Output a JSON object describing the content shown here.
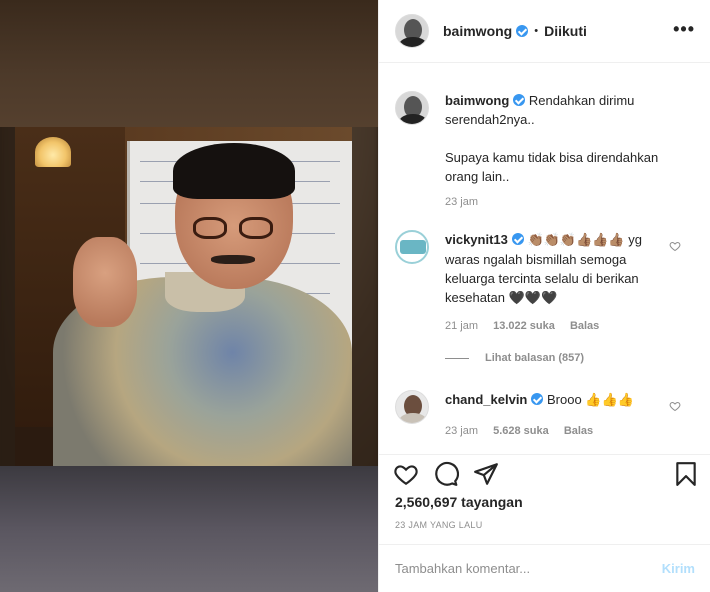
{
  "post": {
    "username": "baimwong",
    "separator": "•",
    "follow_status": "Diikuti",
    "more": "•••"
  },
  "caption": {
    "username": "baimwong",
    "line1": "Rendahkan dirimu",
    "line2": "serendah2nya..",
    "line3": "Supaya kamu tidak bisa direndahkan",
    "line4": "orang lain..",
    "time": "23 jam"
  },
  "comments": [
    {
      "username": "vickynit13",
      "emojis": "👏🏽👏🏽👏🏽👍🏽👍🏽👍🏽",
      "text_end": "yg",
      "line2": "waras ngalah bismillah semoga",
      "line3": "keluarga tercinta selalu di berikan",
      "line4": "kesehatan",
      "hearts": "🖤🖤🖤",
      "time": "21 jam",
      "likes": "13.022 suka",
      "reply": "Balas",
      "view_replies": "Lihat balasan (857)"
    },
    {
      "username": "chand_kelvin",
      "text": "Brooo",
      "emojis": "👍👍👍",
      "time": "23 jam",
      "likes": "5.628 suka",
      "reply": "Balas"
    }
  ],
  "stats": {
    "views": "2,560,697 tayangan",
    "posted": "23 JAM YANG LALU"
  },
  "add_comment": {
    "placeholder": "Tambahkan komentar...",
    "post_label": "Kirim"
  },
  "colors": {
    "verified": "#3897f0",
    "muted": "#8e8e8e",
    "post_disabled": "#b2dffc"
  },
  "icons": [
    "heart-icon",
    "comment-icon",
    "share-icon",
    "bookmark-icon",
    "verified-badge-icon",
    "more-options-icon"
  ]
}
